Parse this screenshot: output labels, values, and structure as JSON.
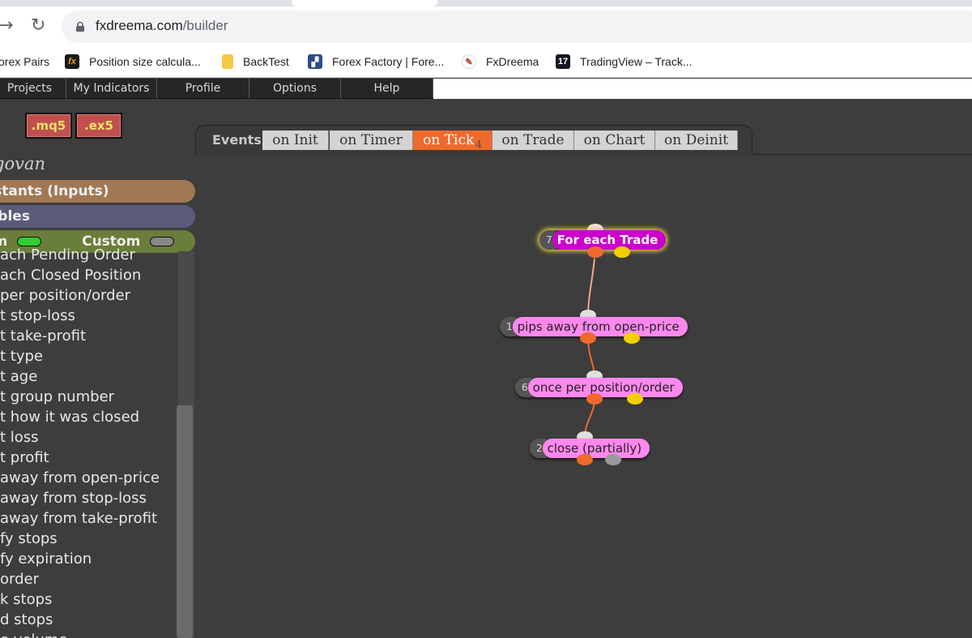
{
  "browser": {
    "url_domain": "fxdreema.com",
    "url_path": "/builder",
    "bookmarks": [
      {
        "label": "orex Pairs",
        "icon": "folder-icon"
      },
      {
        "label": "Position size calcula...",
        "icon": "fx-icon",
        "color": "#e8a317"
      },
      {
        "label": "BackTest",
        "icon": "folder-icon",
        "color": "#f6c945"
      },
      {
        "label": "Forex Factory | Fore...",
        "icon": "forexfactory-icon",
        "color": "#2b4a8a"
      },
      {
        "label": "FxDreema",
        "icon": "fxdreema-icon",
        "color": "#c0392b"
      },
      {
        "label": "TradingView – Track...",
        "icon": "tradingview-icon",
        "color": "#131722"
      }
    ]
  },
  "menubar": [
    "Projects",
    "My Indicators",
    "Profile",
    "Options",
    "Help"
  ],
  "export": {
    "mq5": ".mq5",
    "ex5": ".ex5"
  },
  "sidebar": {
    "title": "govan",
    "constants": "nstants (Inputs)",
    "variables": "iables",
    "tab_system": "em",
    "tab_custom": "Custom",
    "items": [
      "ach Pending Order",
      "ach Closed Position",
      "per position/order",
      "t stop-loss",
      "t take-profit",
      "t type",
      "t age",
      "t group number",
      "t how it was closed",
      "t loss",
      "t profit",
      "away from open-price",
      "away from stop-loss",
      "away from take-profit",
      "fy stops",
      "fy expiration",
      "order",
      "k stops",
      "d stops",
      "e volume"
    ]
  },
  "events": {
    "label": "Events",
    "tabs": [
      {
        "label": "on Init"
      },
      {
        "label": "on Timer"
      },
      {
        "label": "on Tick",
        "count": "4"
      },
      {
        "label": "on Trade"
      },
      {
        "label": "on Chart"
      },
      {
        "label": "on Deinit"
      }
    ]
  },
  "blocks": [
    {
      "id": "7",
      "label": "For each Trade"
    },
    {
      "id": "1",
      "label": "pips away from open-price"
    },
    {
      "id": "6",
      "label": "once per position/order"
    },
    {
      "id": "2",
      "label": "close (partially)"
    }
  ],
  "colors": {
    "accent": "#ee6a2c",
    "block_purple": "#cc00cc",
    "block_pink": "#ff88ee",
    "connector_orange": "#ee6a2c",
    "connector_yellow": "#f0d000"
  }
}
